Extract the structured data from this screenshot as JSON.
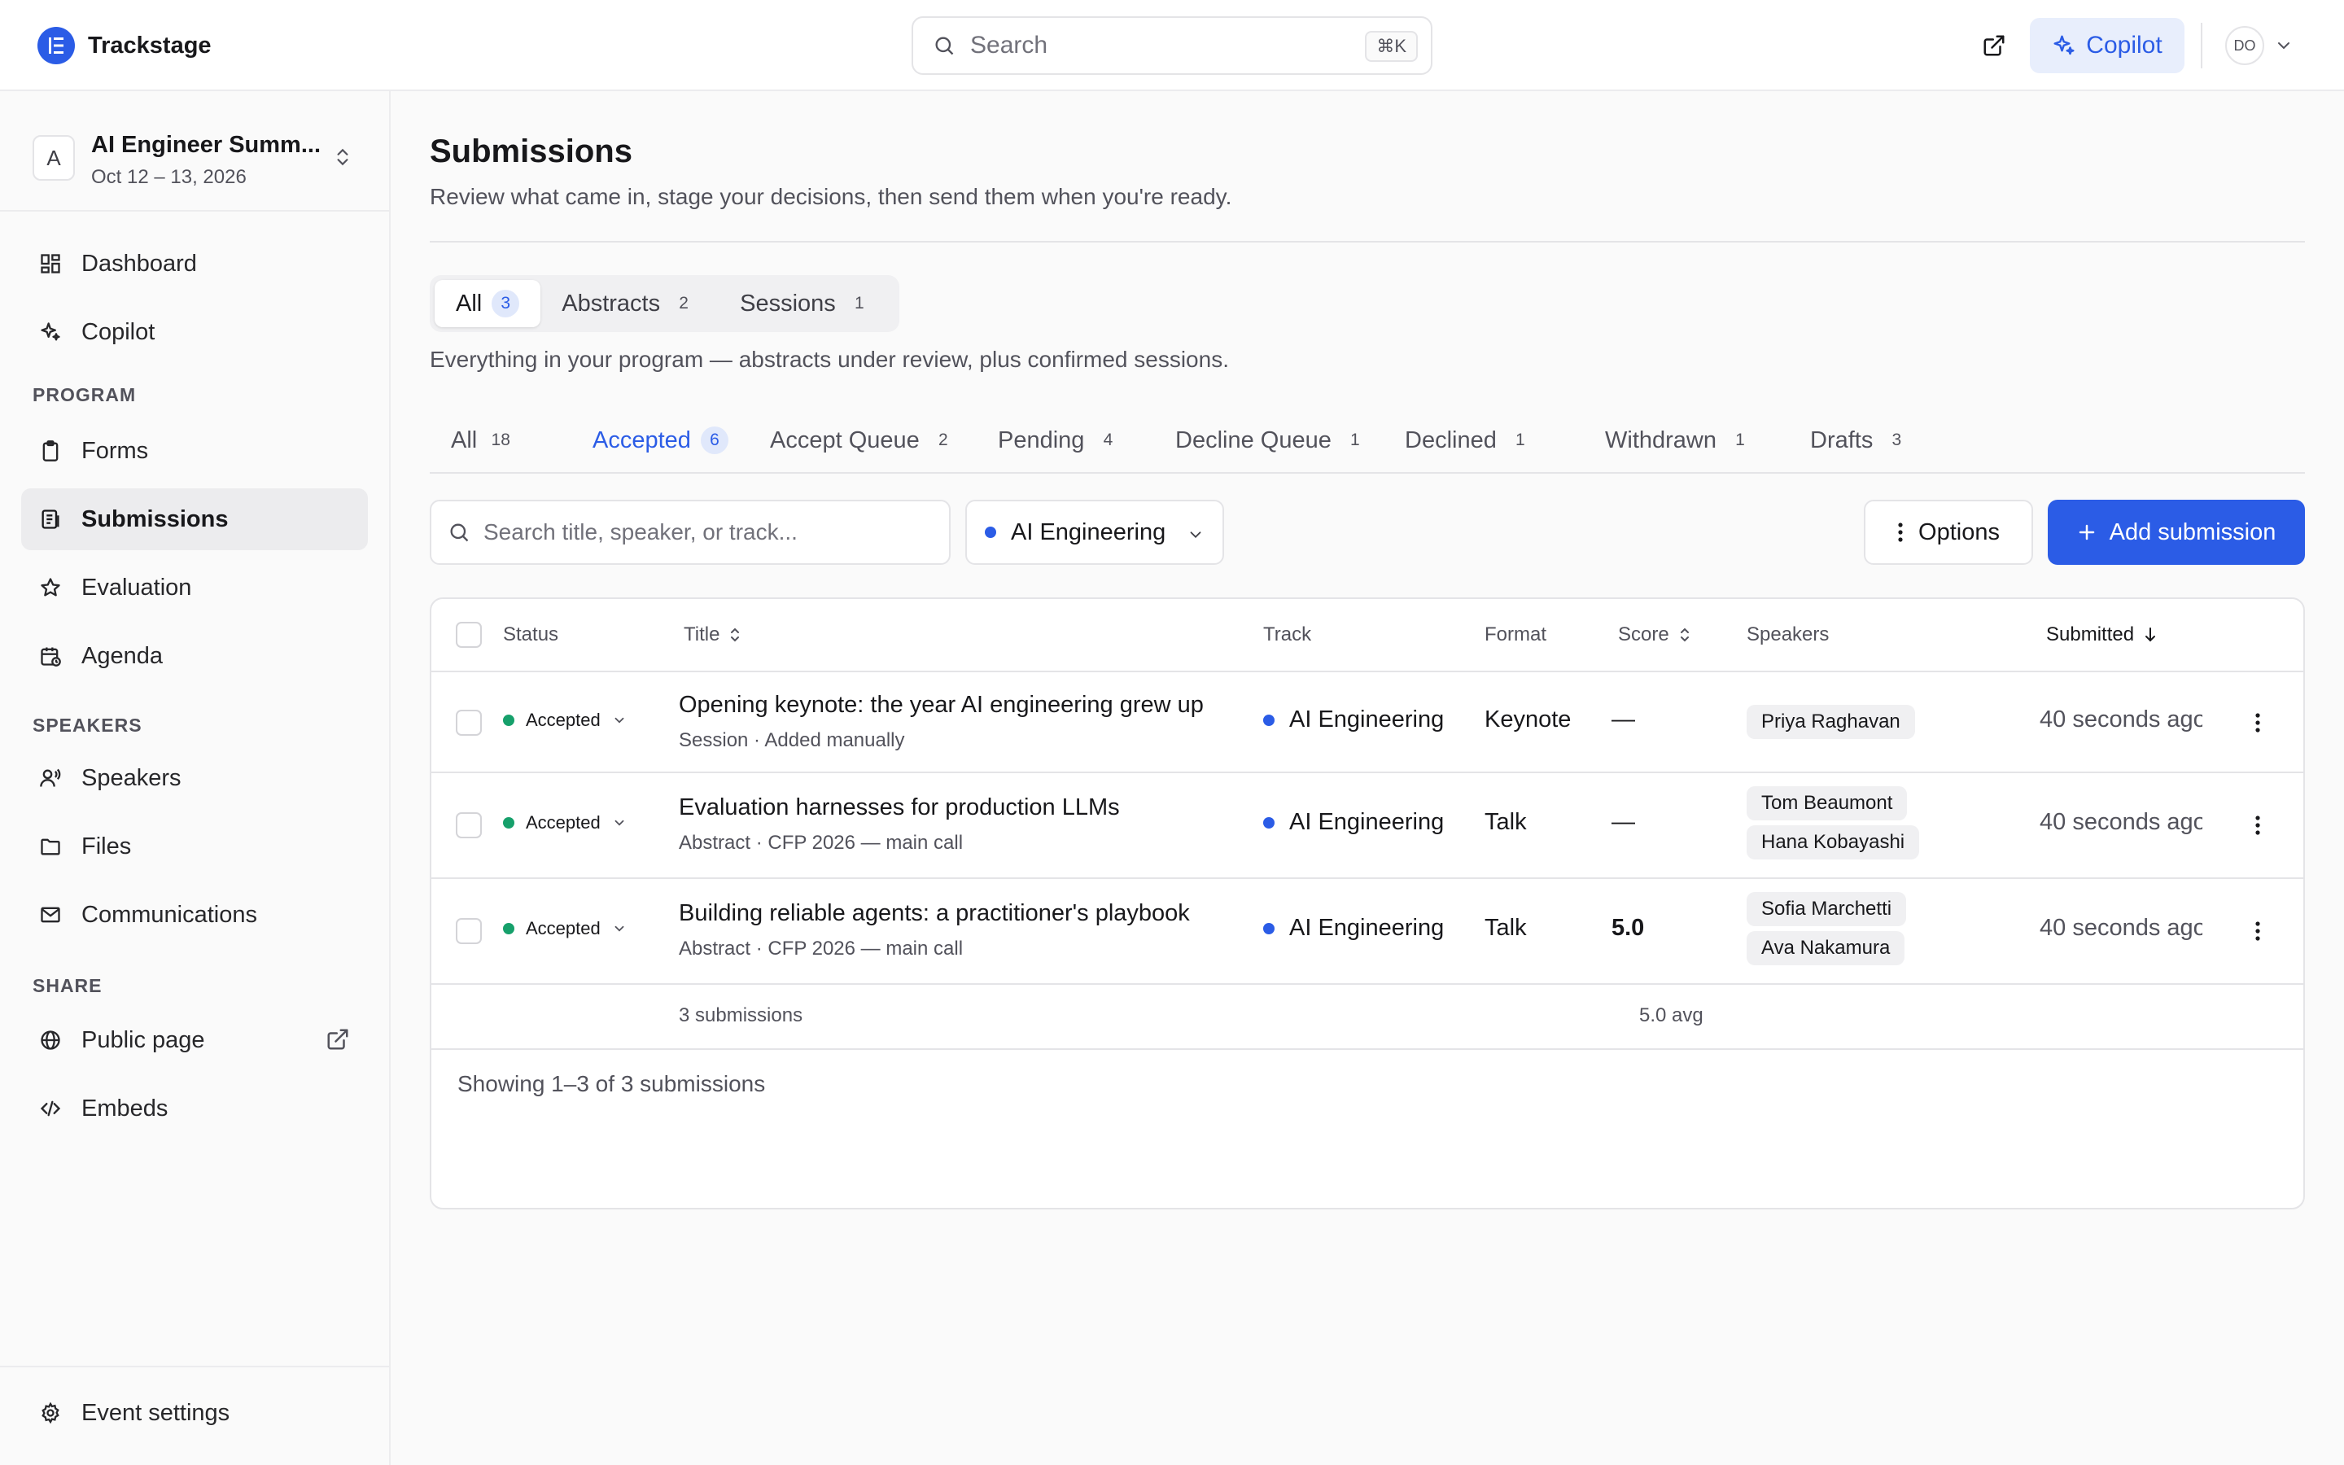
{
  "app": {
    "name": "Trackstage"
  },
  "topbar": {
    "search_placeholder": "Search",
    "shortcut": "⌘K",
    "copilot_label": "Copilot",
    "user_initials": "DO"
  },
  "event": {
    "avatar_letter": "A",
    "name": "AI Engineer Summ...",
    "dates": "Oct 12 – 13, 2026"
  },
  "sidebar": {
    "items": [
      {
        "label": "Dashboard",
        "icon": "dashboard-icon"
      },
      {
        "label": "Copilot",
        "icon": "sparkle-icon"
      }
    ],
    "program_label": "PROGRAM",
    "program_items": [
      {
        "label": "Forms",
        "icon": "clipboard-icon"
      },
      {
        "label": "Submissions",
        "icon": "document-list-icon",
        "active": true
      },
      {
        "label": "Evaluation",
        "icon": "star-icon"
      },
      {
        "label": "Agenda",
        "icon": "calendar-icon"
      }
    ],
    "speakers_label": "SPEAKERS",
    "speakers_items": [
      {
        "label": "Speakers",
        "icon": "speaker-icon"
      },
      {
        "label": "Files",
        "icon": "folder-icon"
      },
      {
        "label": "Communications",
        "icon": "mail-icon"
      }
    ],
    "share_label": "SHARE",
    "share_items": [
      {
        "label": "Public page",
        "icon": "globe-icon"
      },
      {
        "label": "Embeds",
        "icon": "code-icon"
      }
    ],
    "footer_item": {
      "label": "Event settings",
      "icon": "gear-icon"
    }
  },
  "page": {
    "title": "Submissions",
    "subtitle": "Review what came in, stage your decisions, then send them when you're ready."
  },
  "segments": {
    "items": [
      {
        "label": "All",
        "count": "3",
        "active": true
      },
      {
        "label": "Abstracts",
        "count": "2"
      },
      {
        "label": "Sessions",
        "count": "1"
      }
    ],
    "description": "Everything in your program — abstracts under review, plus confirmed sessions."
  },
  "status_tabs": [
    {
      "label": "All",
      "count": "18"
    },
    {
      "label": "Accepted",
      "count": "6",
      "active": true
    },
    {
      "label": "Accept Queue",
      "count": "2"
    },
    {
      "label": "Pending",
      "count": "4"
    },
    {
      "label": "Decline Queue",
      "count": "1"
    },
    {
      "label": "Declined",
      "count": "1"
    },
    {
      "label": "Withdrawn",
      "count": "1"
    },
    {
      "label": "Drafts",
      "count": "3"
    }
  ],
  "filters": {
    "search_placeholder": "Search title, speaker, or track...",
    "track_label": "AI Engineering",
    "track_color": "#2b5ce6",
    "options_label": "Options",
    "add_label": "Add submission"
  },
  "table": {
    "columns": {
      "status": "Status",
      "title": "Title",
      "track": "Track",
      "format": "Format",
      "score": "Score",
      "speakers": "Speakers",
      "submitted": "Submitted"
    },
    "rows": [
      {
        "status": "Accepted",
        "title": "Opening keynote: the year AI engineering grew up",
        "meta": "Session · Added manually",
        "track": "AI Engineering",
        "format": "Keynote",
        "score": "—",
        "speakers": [
          "Priya Raghavan"
        ],
        "submitted": "40 seconds ago"
      },
      {
        "status": "Accepted",
        "title": "Evaluation harnesses for production LLMs",
        "meta": "Abstract · CFP 2026 — main call",
        "track": "AI Engineering",
        "format": "Talk",
        "score": "—",
        "speakers": [
          "Tom Beaumont",
          "Hana Kobayashi"
        ],
        "submitted": "40 seconds ago"
      },
      {
        "status": "Accepted",
        "title": "Building reliable agents: a practitioner's playbook",
        "meta": "Abstract · CFP 2026 — main call",
        "track": "AI Engineering",
        "format": "Talk",
        "score": "5.0",
        "speakers": [
          "Sofia Marchetti",
          "Ava Nakamura"
        ],
        "submitted": "40 seconds ago"
      }
    ],
    "footer_count": "3 submissions",
    "footer_avg": "5.0 avg",
    "pager": "Showing 1–3 of 3 submissions"
  },
  "colors": {
    "accent": "#2b5ce6",
    "accepted": "#16a06b"
  }
}
